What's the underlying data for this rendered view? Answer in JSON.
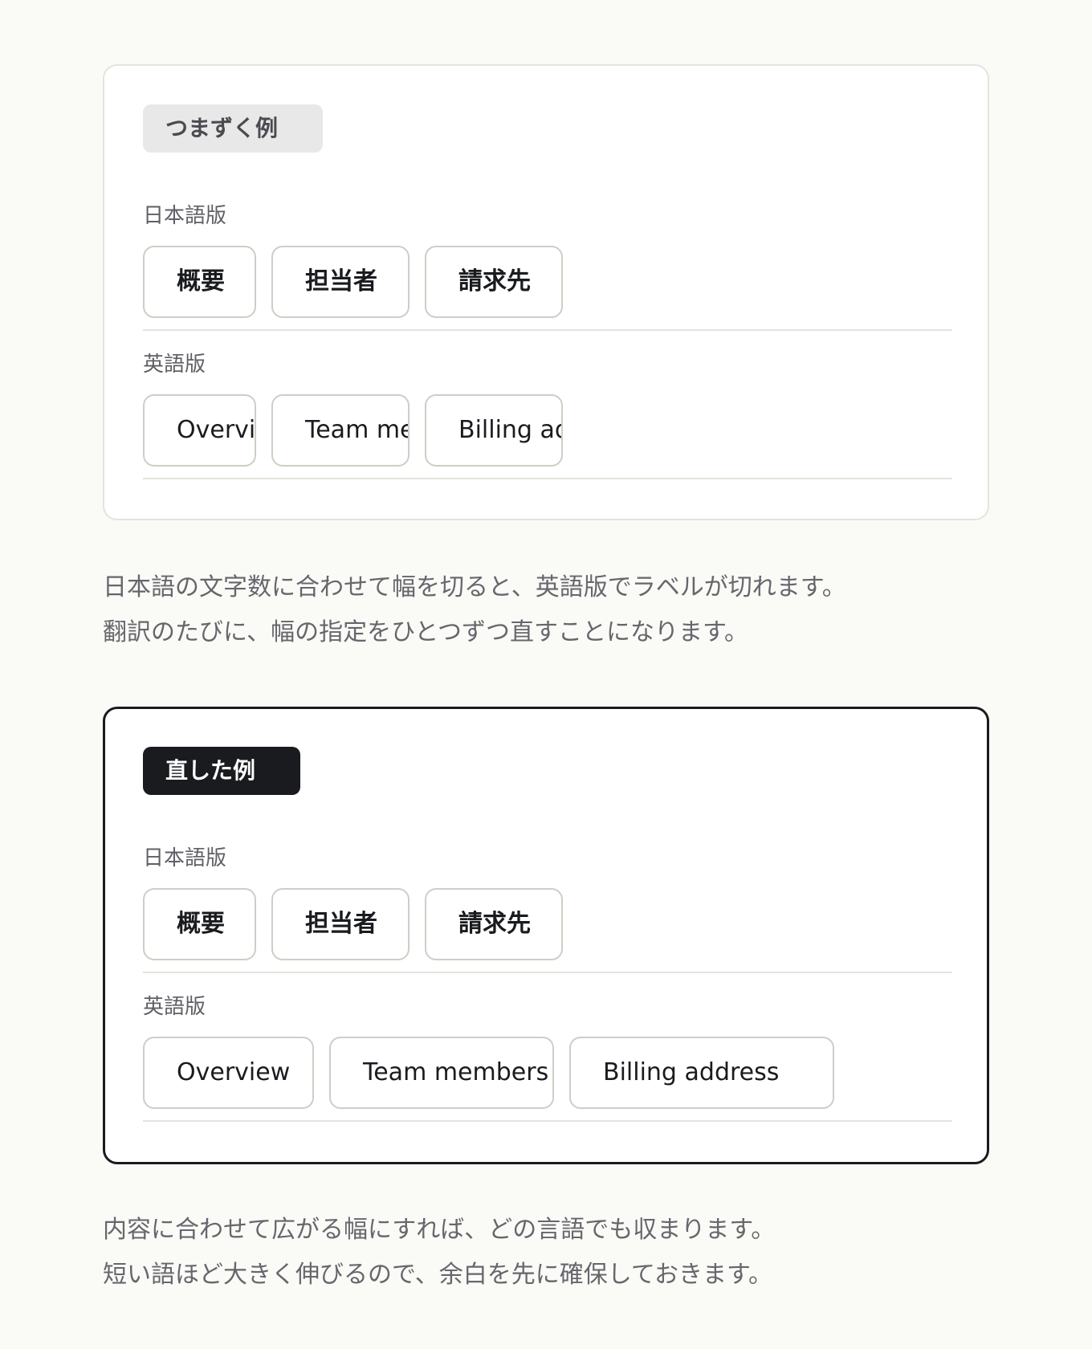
{
  "bad_example": {
    "badge": "つまずく例",
    "jp_label": "日本語版",
    "jp_tabs": [
      "概要",
      "担当者",
      "請求先"
    ],
    "en_label": "英語版",
    "en_tabs": [
      "Overview",
      "Team members",
      "Billing address"
    ]
  },
  "bad_note": {
    "line1": "日本語の文字数に合わせて幅を切ると、英語版でラベルが切れます。",
    "line2": "翻訳のたびに、幅の指定をひとつずつ直すことになります。"
  },
  "good_example": {
    "badge": "直した例",
    "jp_label": "日本語版",
    "jp_tabs": [
      "概要",
      "担当者",
      "請求先"
    ],
    "en_label": "英語版",
    "en_tabs": [
      "Overview",
      "Team members",
      "Billing address"
    ]
  },
  "good_note": {
    "line1": "内容に合わせて広がる幅にすれば、どの言語でも収まります。",
    "line2": "短い語ほど大きく伸びるので、余白を先に確保しておきます。"
  }
}
